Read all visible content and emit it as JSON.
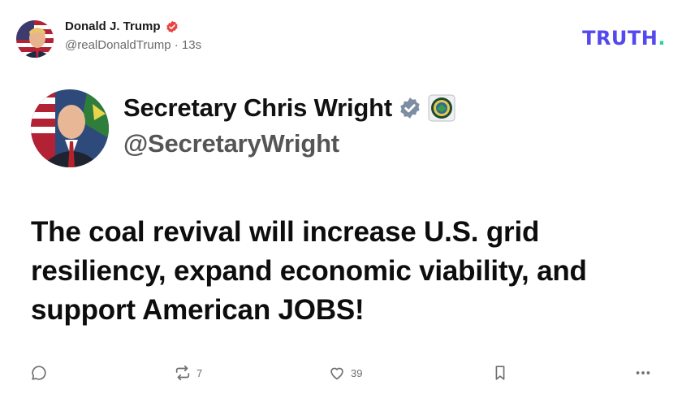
{
  "post": {
    "author_name": "Donald J. Trump",
    "author_handle": "@realDonaldTrump",
    "separator": "·",
    "time_ago": "13s",
    "verified_icon": "verified-badge-icon"
  },
  "brand": {
    "wordmark": "TRUTH",
    "dot": ".",
    "color": "#5448ee",
    "dot_color": "#27d3a3"
  },
  "embed": {
    "name": "Secretary Chris Wright",
    "handle": "@SecretaryWright",
    "verified_icon": "verified-gray-badge-icon",
    "affiliation_icon": "department-of-energy-seal-icon",
    "text": "The coal revival will increase U.S. grid resiliency, expand economic viability, and support American JOBS!"
  },
  "actions": {
    "reply": {
      "icon": "reply-icon",
      "count": ""
    },
    "retruth": {
      "icon": "retruth-icon",
      "count": "7"
    },
    "like": {
      "icon": "heart-icon",
      "count": "39"
    },
    "bookmark": {
      "icon": "bookmark-icon"
    },
    "more": {
      "icon": "more-icon"
    }
  },
  "colors": {
    "verified_red": "#e8433f",
    "verified_gray": "#7d8ea3",
    "text": "#0f0f0f",
    "muted": "#6b6b6b"
  }
}
